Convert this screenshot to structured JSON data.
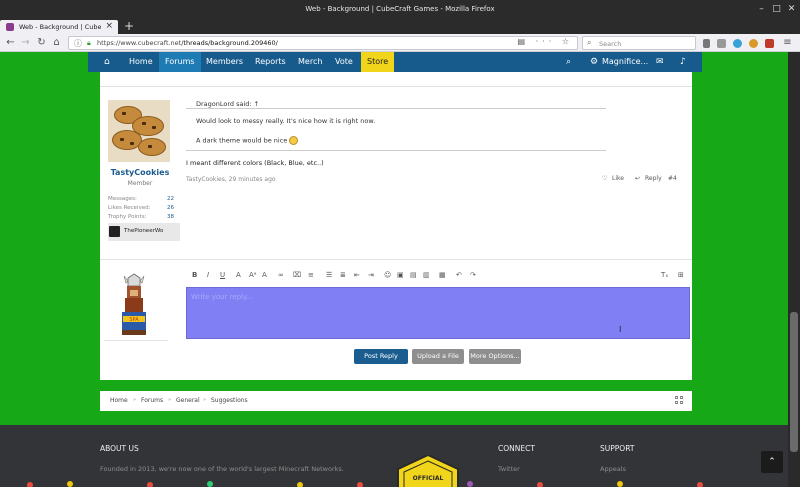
{
  "browser": {
    "window_title": "Web - Background | CubeCraft Games - Mozilla Firefox",
    "tab_title": "Web - Background | CubeCraf",
    "url_prefix": "https://www.cubecraft.net",
    "url_path": "/threads/background.209460/",
    "search_placeholder": "Search"
  },
  "sitenav": {
    "items": [
      "Home",
      "Forums",
      "Members",
      "Reports",
      "Merch",
      "Vote",
      "Store"
    ],
    "active": "Forums",
    "user": "Magnifice..."
  },
  "post": {
    "username": "TastyCookies",
    "role": "Member",
    "stats": [
      {
        "label": "Messages:",
        "value": "22"
      },
      {
        "label": "Likes Received:",
        "value": "26"
      },
      {
        "label": "Trophy Points:",
        "value": "38"
      }
    ],
    "badge": "ThePioneerWo",
    "quote_author": "DragonLord said: ↑",
    "quote_line1": "Would look to messy really. It's nice how it is right now.",
    "quote_line2": "A dark theme would be nice",
    "reply_text": "I meant different colors (Black, Blue, etc..)",
    "meta": "TastyCookies, 29 minutes ago",
    "like_label": "Like",
    "reply_label": "Reply",
    "post_number": "#4"
  },
  "editor": {
    "placeholder": "Write your reply...",
    "post_label": "Post Reply",
    "upload_label": "Upload a File",
    "more_label": "More Options..."
  },
  "breadcrumb": [
    "Home",
    "Forums",
    "General",
    "Suggestions"
  ],
  "footer": {
    "about_title": "ABOUT US",
    "about_text": "Founded in 2013, we're now one of the world's largest Minecraft Networks.",
    "connect_title": "CONNECT",
    "connect_item": "Twitter",
    "support_title": "SUPPORT",
    "support_item": "Appeals",
    "logo_text": "OFFICIAL"
  },
  "colors": {
    "page_background": "#16a816",
    "nav_bar": "#165b8c",
    "nav_active": "#1e7bb3",
    "store": "#f1d51a",
    "editor_bg": "#8080f4",
    "post_button": "#1c5d8f"
  }
}
